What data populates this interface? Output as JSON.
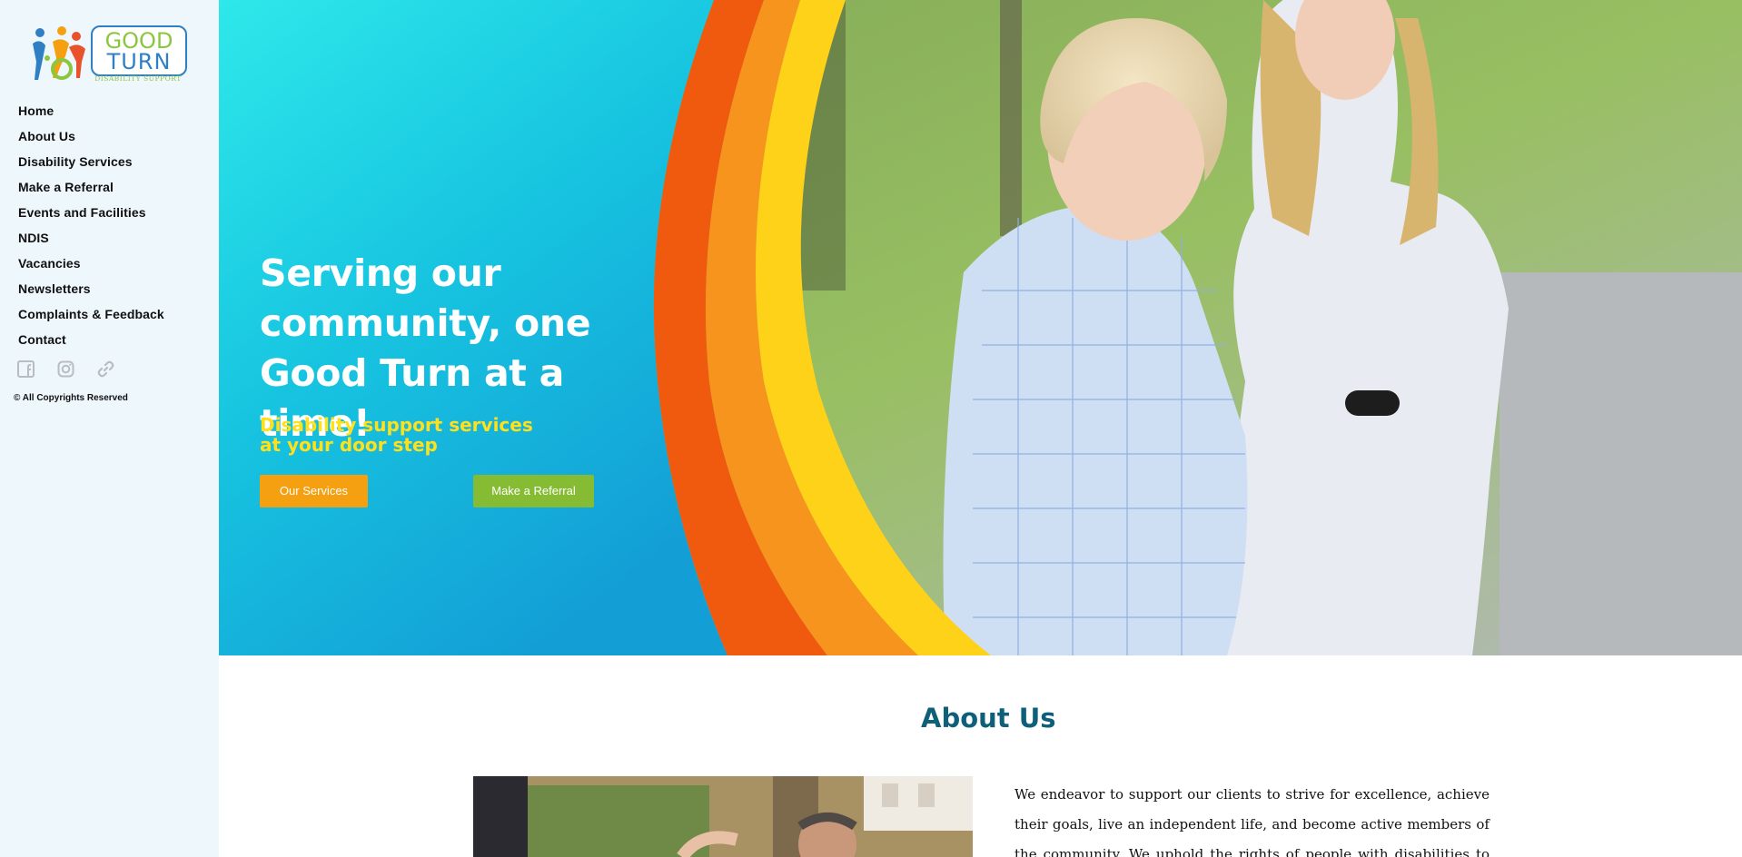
{
  "brand": {
    "logo_word1": "GOOD",
    "logo_word2": "TURN",
    "logo_tagline": "DISABILITY SUPPORT",
    "colors": {
      "green": "#8cc63f",
      "blue": "#2f7fc4",
      "orange": "#f4a011",
      "teal": "#0e5f7a"
    }
  },
  "sidebar": {
    "nav": [
      {
        "label": "Home"
      },
      {
        "label": "About Us"
      },
      {
        "label": "Disability Services"
      },
      {
        "label": "Make a Referral"
      },
      {
        "label": "Events and Facilities"
      },
      {
        "label": "NDIS"
      },
      {
        "label": "Vacancies"
      },
      {
        "label": "Newsletters"
      },
      {
        "label": "Complaints & Feedback"
      },
      {
        "label": "Contact"
      }
    ],
    "social_icons": [
      "facebook-icon",
      "instagram-icon",
      "link-icon"
    ],
    "copyright": "© All Copyrights Reserved"
  },
  "hero": {
    "title": "Serving our community, one Good Turn at a time!",
    "subtitle_line1": "Disability support services",
    "subtitle_line2": "at your door step",
    "primary_button": "Our Services",
    "secondary_button": "Make a Referral"
  },
  "about": {
    "heading": "About Us",
    "paragraph": "We endeavor to support our clients to strive for excellence, achieve their goals, live an independent life, and become active members of the community. We uphold the rights of people with disabilities to enhance their social and economic"
  }
}
